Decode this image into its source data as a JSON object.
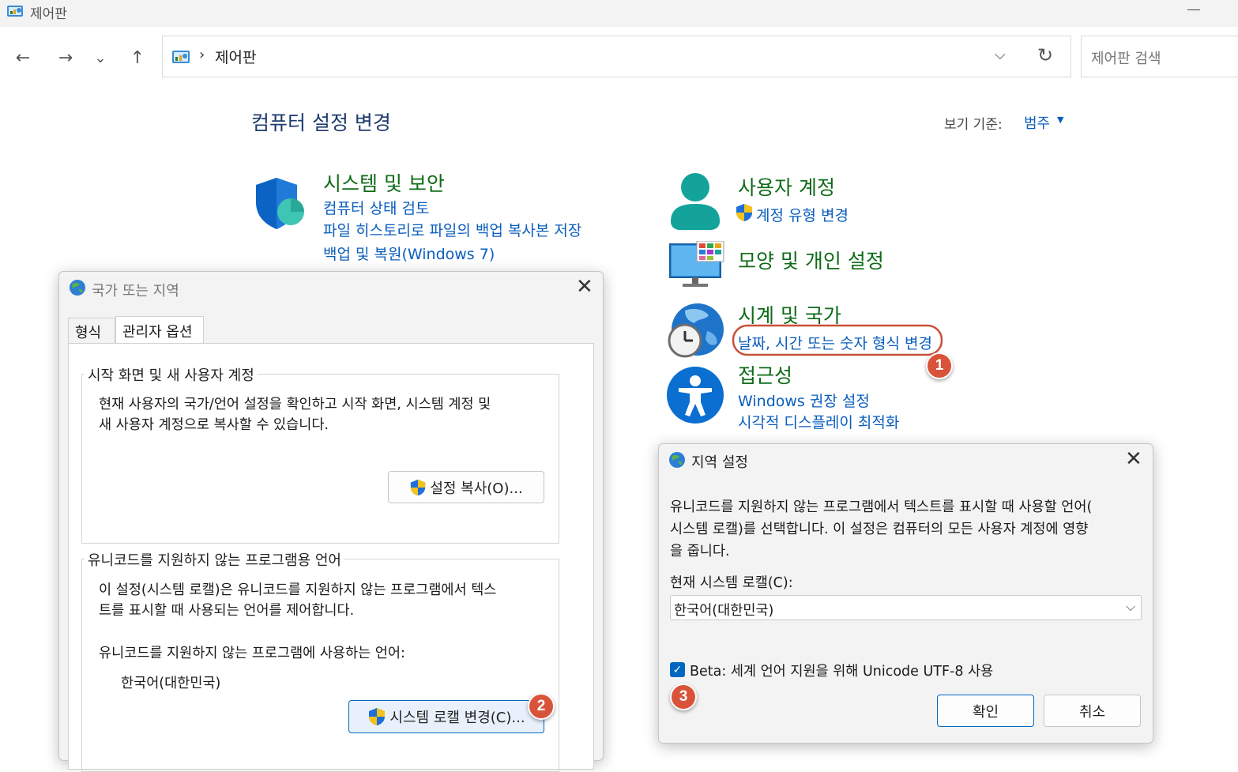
{
  "window": {
    "title": "제어판"
  },
  "nav": {
    "back": "←",
    "forward": "→",
    "recent": "⌄",
    "up": "↑",
    "breadcrumb_sep": "›",
    "breadcrumb": "제어판",
    "dropdown": "⌵",
    "refresh": "↻",
    "search_placeholder": "제어판 검색"
  },
  "main": {
    "heading": "컴퓨터 설정 변경",
    "view_by_label": "보기 기준:",
    "view_by_value": "범주",
    "categories": [
      {
        "title": "시스템 및 보안",
        "icon": "shield-icon",
        "links": [
          "컴퓨터 상태 검토",
          "파일 히스토리로 파일의 백업 복사본 저장",
          "백업 및 복원(Windows 7)"
        ]
      },
      {
        "title": "사용자 계정",
        "icon": "user-icon",
        "links": [
          "계정 유형 변경"
        ]
      },
      {
        "title": "모양 및 개인 설정",
        "icon": "monitor-icon",
        "links": []
      },
      {
        "title": "시계 및 국가",
        "icon": "clock-globe-icon",
        "links": [
          "날짜, 시간 또는 숫자 형식 변경"
        ]
      },
      {
        "title": "접근성",
        "icon": "accessibility-icon",
        "links": [
          "Windows 권장 설정",
          "시각적 디스플레이 최적화"
        ]
      }
    ]
  },
  "region_dialog": {
    "title": "국가 또는 지역",
    "tabs": [
      "형식",
      "관리자 옵션"
    ],
    "welcome_group": {
      "title": "시작 화면 및 새 사용자 계정",
      "text_line1": "현재 사용자의 국가/언어 설정을 확인하고 시작 화면, 시스템 계정 및",
      "text_line2": "새 사용자 계정으로 복사할 수 있습니다.",
      "button": "설정 복사(O)..."
    },
    "unicode_group": {
      "title": "유니코드를 지원하지 않는 프로그램용 언어",
      "text_line1": "이 설정(시스템 로캘)은 유니코드를 지원하지 않는 프로그램에서 텍스",
      "text_line2": "트를 표시할 때 사용되는 언어를 제어합니다.",
      "label": "유니코드를 지원하지 않는 프로그램에 사용하는 언어:",
      "value": "한국어(대한민국)",
      "button": "시스템 로캘 변경(C)..."
    }
  },
  "locale_dialog": {
    "title": "지역 설정",
    "desc_line1": "유니코드를 지원하지 않는 프로그램에서 텍스트를 표시할 때 사용할 언어(",
    "desc_line2": "시스템 로캘)를 선택합니다. 이 설정은 컴퓨터의 모든 사용자 계정에 영향",
    "desc_line3": "을 줍니다.",
    "current_label": "현재 시스템 로캘(C):",
    "current_value": "한국어(대한민국)",
    "beta_checked": true,
    "beta_label": "Beta: 세계 언어 지원을 위해 Unicode UTF-8 사용",
    "ok": "확인",
    "cancel": "취소"
  },
  "annotations": {
    "badge1": "1",
    "badge2": "2",
    "badge3": "3"
  },
  "colors": {
    "link": "#0a5ebd",
    "category": "#0f6b18",
    "badge": "#d9533a",
    "highlight": "#c9503a"
  }
}
